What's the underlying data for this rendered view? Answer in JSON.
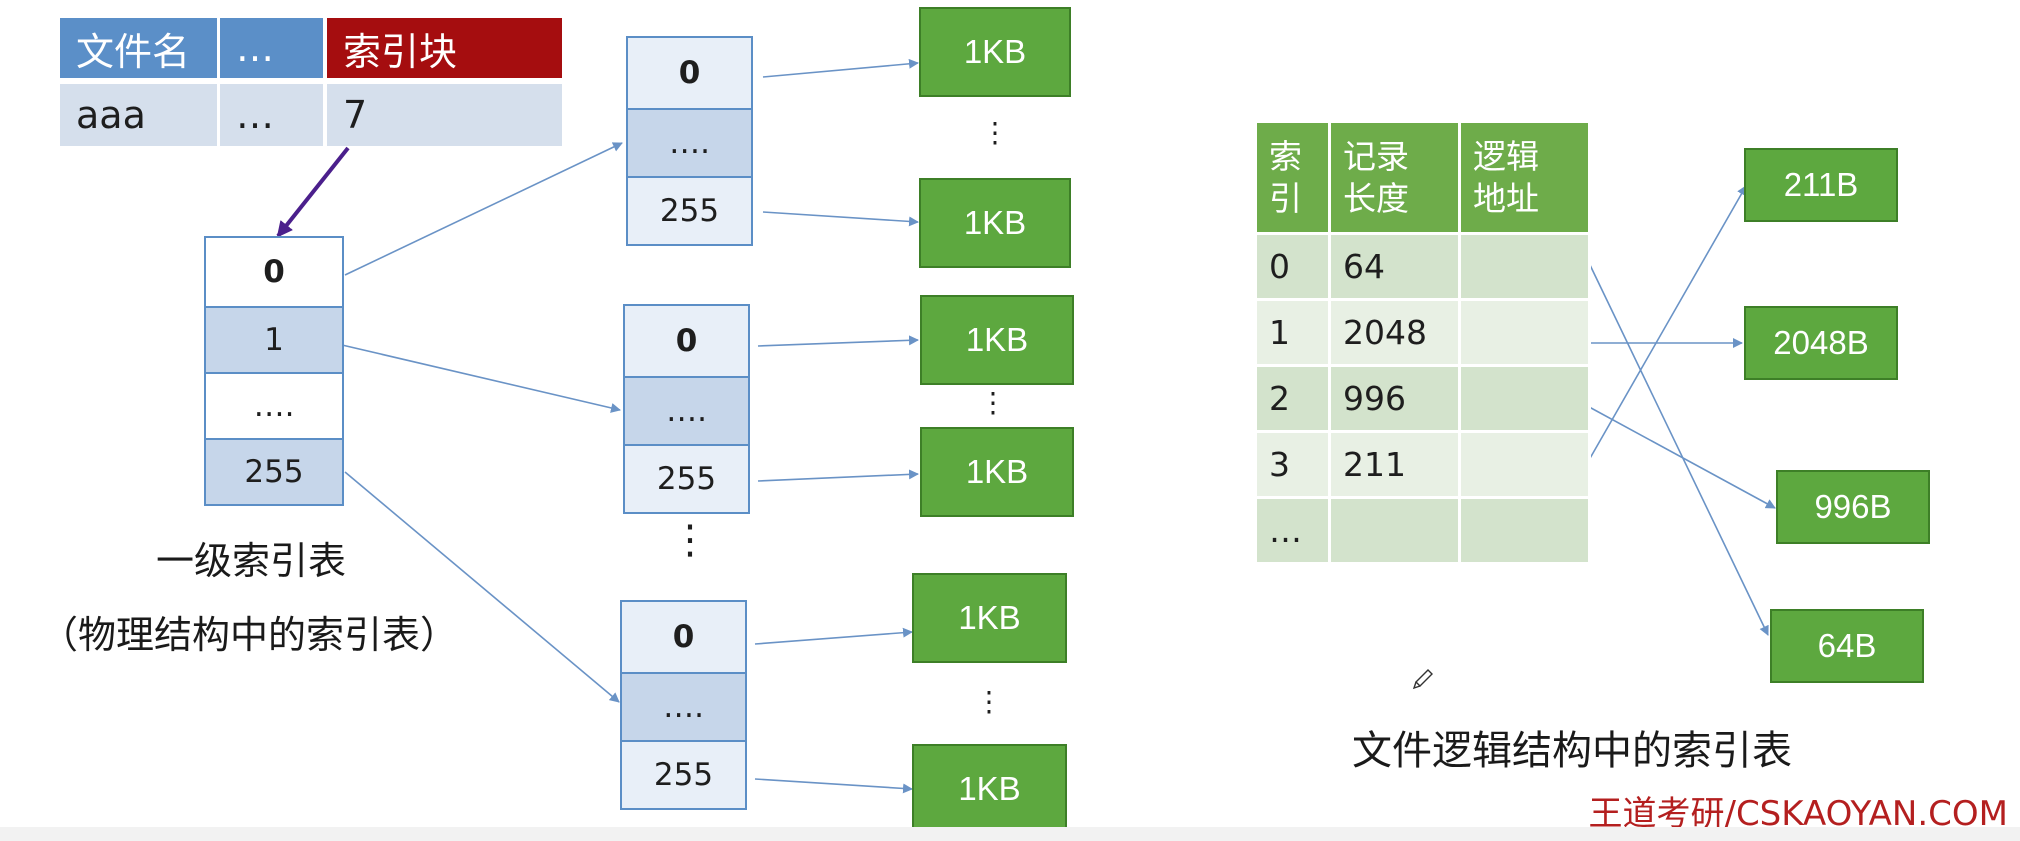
{
  "directory": {
    "headers": [
      "文件名",
      "…",
      "索引块"
    ],
    "row": [
      "aaa",
      "…",
      "7"
    ]
  },
  "first_level": {
    "cells": [
      "0",
      "1",
      "….",
      "255"
    ],
    "caption": "一级索引表",
    "subcaption": "（物理结构中的索引表）"
  },
  "second_level": [
    {
      "cells": [
        "0",
        "….",
        "255"
      ]
    },
    {
      "cells": [
        "0",
        "….",
        "255"
      ]
    },
    {
      "cells": [
        "0",
        "….",
        "255"
      ]
    }
  ],
  "data_blocks": [
    "1KB",
    "1KB",
    "1KB",
    "1KB",
    "1KB",
    "1KB"
  ],
  "ellipsis": "⋮",
  "logical_table": {
    "headers": [
      "索\n引",
      "记录\n长度",
      "逻辑\n地址"
    ],
    "rows": [
      [
        "0",
        "64",
        ""
      ],
      [
        "1",
        "2048",
        ""
      ],
      [
        "2",
        "996",
        ""
      ],
      [
        "3",
        "211",
        ""
      ],
      [
        "…",
        "",
        ""
      ]
    ],
    "caption": "文件逻辑结构中的索引表"
  },
  "record_blocks": [
    "211B",
    "2048B",
    "996B",
    "64B"
  ],
  "watermark": "王道考研/CSKAOYAN.COM",
  "colors": {
    "header_blue": "#5b8fc8",
    "header_red": "#a50d0f",
    "block_border": "#5b8ec6",
    "green": "#5da83f",
    "arrow_blue": "#6a93c6",
    "arrow_purple": "#4b1f8c",
    "watermark_red": "#b41f1f"
  }
}
